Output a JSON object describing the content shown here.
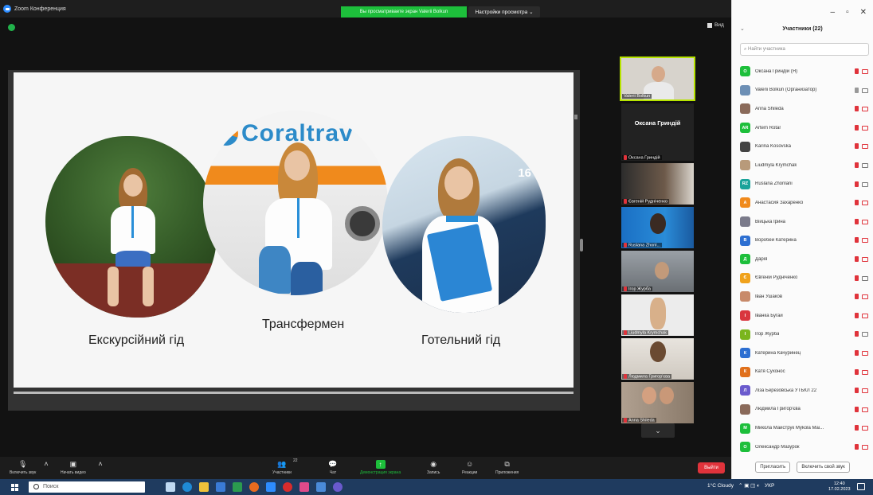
{
  "window": {
    "app_title": "Zoom Конференция"
  },
  "banner": {
    "sharing_text": "Вы просматриваете экран Valerii Bolkun",
    "view_settings": "Настройки просмотра ⌄"
  },
  "meeting": {
    "view_label": "Вид"
  },
  "slide": {
    "logo_text": "Coraltrav",
    "bus_number": "16",
    "captions": [
      "Екскурсійний гід",
      "Трансфермен",
      "Готельний гід"
    ]
  },
  "video_strip": {
    "top_name": "Valerii Bolkun",
    "active_name": "Оксана Гриндій",
    "active_sub": "Оксана Гриндій",
    "tiles": [
      "Євгеній Рудніченко",
      "Ruslana Zhonl...",
      "Ігор Журба",
      "Liudmyla Krymchak",
      "Людмила Григор'єва",
      "Anna Shileda"
    ]
  },
  "toolbar": {
    "items": [
      {
        "label": "Включить звук",
        "icon": "mic-muted-icon"
      },
      {
        "label": "Начать видео",
        "icon": "video-off-icon"
      },
      {
        "label": "Участники",
        "icon": "participants-icon",
        "count": "22"
      },
      {
        "label": "Чат",
        "icon": "chat-icon"
      },
      {
        "label": "Демонстрация экрана",
        "icon": "share-screen-icon"
      },
      {
        "label": "Запись",
        "icon": "record-icon"
      },
      {
        "label": "Реакции",
        "icon": "reactions-icon"
      },
      {
        "label": "Приложения",
        "icon": "apps-icon"
      }
    ],
    "leave_label": "Выйти"
  },
  "panel": {
    "title": "Участники (22)",
    "search_placeholder": "Найти участника",
    "participants": [
      {
        "initial": "О",
        "name": "Оксана Гриндій (Я)",
        "color": "#1dbf3b",
        "mic": "muted",
        "cam": "off"
      },
      {
        "initial": "",
        "name": "Valerii Bolkun (Организатор)",
        "color": "#6d8fb5",
        "mic": "on",
        "cam": "on"
      },
      {
        "initial": "",
        "name": "Anna Shileda",
        "color": "#8a6a5a",
        "mic": "muted",
        "cam": "off"
      },
      {
        "initial": "AR",
        "name": "Artem Rotar",
        "color": "#1dbf3b",
        "mic": "muted",
        "cam": "off"
      },
      {
        "initial": "",
        "name": "Karina Kosovska",
        "color": "#444444",
        "mic": "muted",
        "cam": "off"
      },
      {
        "initial": "",
        "name": "Liudmyla Krymchak",
        "color": "#b89a7a",
        "mic": "muted",
        "cam": "on"
      },
      {
        "initial": "RZ",
        "name": "Ruslana Zhonlani",
        "color": "#1aa39a",
        "mic": "muted",
        "cam": "on"
      },
      {
        "initial": "А",
        "name": "Анастасия Захаренко",
        "color": "#f08a1c",
        "mic": "muted",
        "cam": "off"
      },
      {
        "initial": "",
        "name": "Вiйцька Ірина",
        "color": "#7a7a8a",
        "mic": "muted",
        "cam": "off"
      },
      {
        "initial": "В",
        "name": "Воробей Катерина",
        "color": "#2d6fd1",
        "mic": "muted",
        "cam": "off"
      },
      {
        "initial": "Д",
        "name": "Дарія",
        "color": "#1dbf3b",
        "mic": "muted",
        "cam": "off"
      },
      {
        "initial": "Є",
        "name": "Євгеній Рудніченко",
        "color": "#f0a21c",
        "mic": "muted",
        "cam": "on"
      },
      {
        "initial": "",
        "name": "Іван Ушаков",
        "color": "#c88a6a",
        "mic": "muted",
        "cam": "off"
      },
      {
        "initial": "І",
        "name": "Іванка Бугай",
        "color": "#d9363e",
        "mic": "muted",
        "cam": "off"
      },
      {
        "initial": "І",
        "name": "Ігор Журба",
        "color": "#7ab51d",
        "mic": "muted",
        "cam": "on"
      },
      {
        "initial": "К",
        "name": "Катерина Качуринец",
        "color": "#2d6fd1",
        "mic": "muted",
        "cam": "off"
      },
      {
        "initial": "К",
        "name": "Катя Сухонос",
        "color": "#e0701c",
        "mic": "muted",
        "cam": "off"
      },
      {
        "initial": "Л",
        "name": "Ліза Березовська УТБКЛ 22",
        "color": "#6a5acd",
        "mic": "muted",
        "cam": "off"
      },
      {
        "initial": "",
        "name": "Людмила Григор'єва",
        "color": "#8a6a5a",
        "mic": "muted",
        "cam": "off"
      },
      {
        "initial": "М",
        "name": "Микола Майструк Mykola Mai...",
        "color": "#1dbf3b",
        "mic": "muted",
        "cam": "off"
      },
      {
        "initial": "О",
        "name": "Олександр Мазурок",
        "color": "#1dbf3b",
        "mic": "muted",
        "cam": "off"
      }
    ],
    "invite_label": "Пригласить",
    "unmute_label": "Включить свой звук"
  },
  "taskbar": {
    "search_placeholder": "Поиск",
    "weather": "1°C Cloudy",
    "lang": "УКР",
    "time": "12:40",
    "date": "17.02.2023"
  }
}
